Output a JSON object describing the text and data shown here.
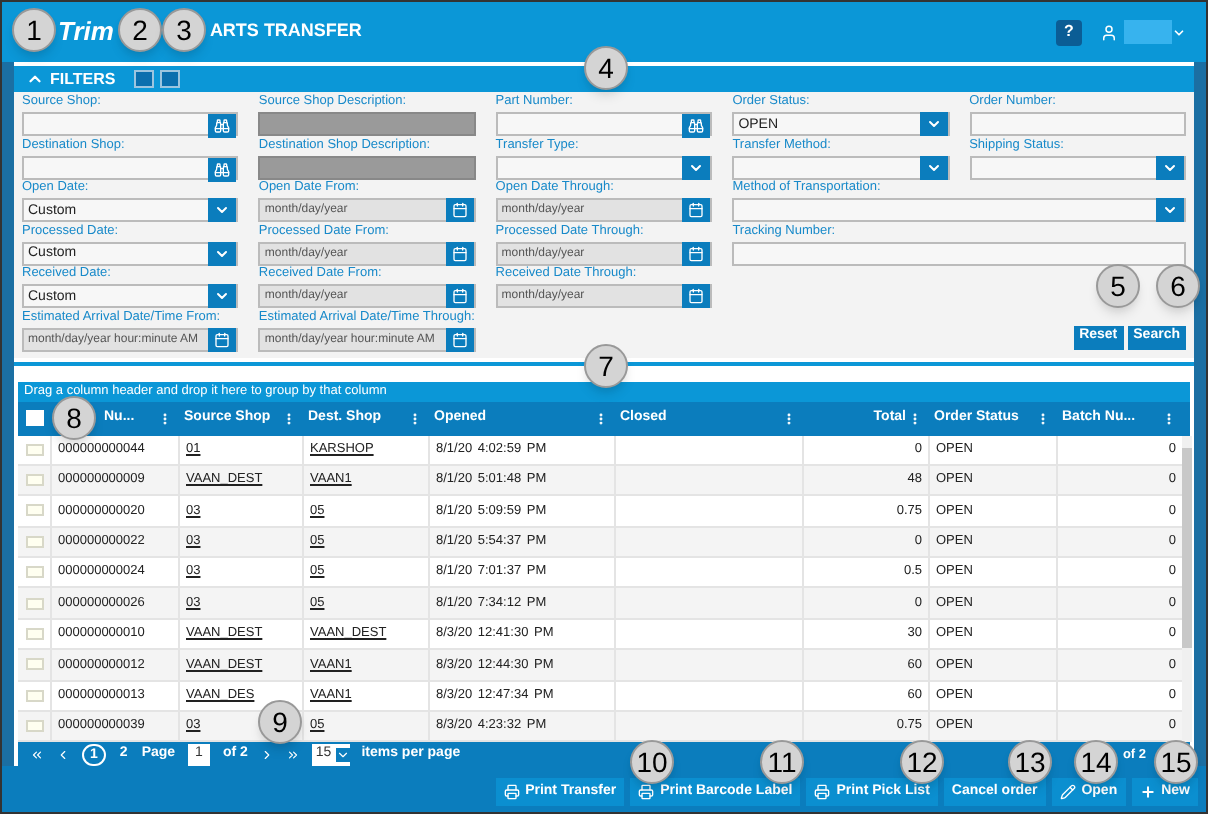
{
  "header": {
    "logo": "Trim",
    "title": "ARTS TRANSFER",
    "help": "?"
  },
  "filters": {
    "title": "FILTERS",
    "expanded": true,
    "fields": [
      {
        "label": "Source Shop:",
        "kind": "lookup"
      },
      {
        "label": "Source Shop Description:",
        "kind": "readonly"
      },
      {
        "label": "Part Number:",
        "kind": "lookup"
      },
      {
        "label": "Order Status:",
        "kind": "select",
        "value": "OPEN"
      },
      {
        "label": "Order Number:",
        "kind": "text"
      },
      {
        "label": "Destination Shop:",
        "kind": "lookup"
      },
      {
        "label": "Destination Shop Description:",
        "kind": "readonly"
      },
      {
        "label": "Transfer Type:",
        "kind": "select"
      },
      {
        "label": "Transfer Method:",
        "kind": "select"
      },
      {
        "label": "Shipping Status:",
        "kind": "select"
      },
      {
        "label": "Open Date:",
        "kind": "select",
        "value": "Custom"
      },
      {
        "label": "Open Date From:",
        "kind": "date",
        "placeholder": "month/day/year"
      },
      {
        "label": "Open Date Through:",
        "kind": "date",
        "placeholder": "month/day/year"
      },
      {
        "label": "Method of Transportation:",
        "kind": "select",
        "wide": true
      },
      {
        "label": "Processed Date:",
        "kind": "select",
        "value": "Custom"
      },
      {
        "label": "Processed Date From:",
        "kind": "date",
        "placeholder": "month/day/year"
      },
      {
        "label": "Processed Date Through:",
        "kind": "date",
        "placeholder": "month/day/year"
      },
      {
        "label": "Tracking Number:",
        "kind": "text",
        "wide": true
      },
      {
        "label": "Received Date:",
        "kind": "select",
        "value": "Custom"
      },
      {
        "label": "Received Date From:",
        "kind": "date",
        "placeholder": "month/day/year"
      },
      {
        "label": "Received Date Through:",
        "kind": "date",
        "placeholder": "month/day/year"
      },
      {
        "label": "Estimated Arrival Date/Time From:",
        "kind": "date",
        "placeholder": "month/day/year hour:minute AM",
        "newline": true
      },
      {
        "label": "Estimated Arrival Date/Time Through:",
        "kind": "date",
        "placeholder": "month/day/year hour:minute AM"
      }
    ],
    "buttons": [
      "Reset",
      "Search"
    ]
  },
  "grid": {
    "group_hint": "Drag a column header and drop it here to group by that column",
    "select_all": {
      "checked": false
    },
    "columns": [
      "Nu...",
      "Source Shop",
      "Dest. Shop",
      "Opened",
      "Closed",
      "Total",
      "Order Status",
      "Batch Nu..."
    ],
    "rows": [
      {
        "checked": false,
        "cells": [
          "000000000044",
          "01",
          "KARSHOP",
          "8/1/20 4:02:59 PM",
          "",
          "0",
          "OPEN",
          "0"
        ]
      },
      {
        "checked": false,
        "cells": [
          "000000000009",
          "VAAN_DEST",
          "VAAN1",
          "8/1/20 5:01:48 PM",
          "",
          "48",
          "OPEN",
          "0"
        ]
      },
      {
        "checked": false,
        "cells": [
          "000000000020",
          "03",
          "05",
          "8/1/20 5:09:59 PM",
          "",
          "0.75",
          "OPEN",
          "0"
        ]
      },
      {
        "checked": false,
        "cells": [
          "000000000022",
          "03",
          "05",
          "8/1/20 5:54:37 PM",
          "",
          "0",
          "OPEN",
          "0"
        ]
      },
      {
        "checked": false,
        "cells": [
          "000000000024",
          "03",
          "05",
          "8/1/20 7:01:37 PM",
          "",
          "0.5",
          "OPEN",
          "0"
        ]
      },
      {
        "checked": false,
        "cells": [
          "000000000026",
          "03",
          "05",
          "8/1/20 7:34:12 PM",
          "",
          "0",
          "OPEN",
          "0"
        ]
      },
      {
        "checked": false,
        "cells": [
          "000000000010",
          "VAAN_DEST",
          "VAAN_DEST",
          "8/3/20 12:41:30 PM",
          "",
          "30",
          "OPEN",
          "0"
        ]
      },
      {
        "checked": false,
        "cells": [
          "000000000012",
          "VAAN_DEST",
          "VAAN1",
          "8/3/20 12:44:30 PM",
          "",
          "60",
          "OPEN",
          "0"
        ]
      },
      {
        "checked": false,
        "cells": [
          "000000000013",
          "VAAN_DES",
          "VAAN1",
          "8/3/20 12:47:34 PM",
          "",
          "60",
          "OPEN",
          "0"
        ]
      },
      {
        "checked": false,
        "cells": [
          "000000000039",
          "03",
          "05",
          "8/3/20 4:23:32 PM",
          "",
          "0.75",
          "OPEN",
          "0"
        ]
      }
    ]
  },
  "pager": {
    "pages": [
      {
        "label": "1",
        "selected": true
      },
      {
        "label": "2",
        "selected": false
      }
    ],
    "page_label": "Page",
    "page_value": "1",
    "of_pages": "of 2",
    "page_size": "15",
    "page_size_label": "items per page",
    "summary": "of 2"
  },
  "toolbar": [
    {
      "label": "Print Transfer",
      "kind": "print"
    },
    {
      "label": "Print Barcode Label",
      "kind": "print"
    },
    {
      "label": "Print Pick List",
      "kind": "print"
    },
    {
      "label": "Cancel order",
      "kind": "plain"
    },
    {
      "label": "Open",
      "kind": "edit"
    },
    {
      "label": "New",
      "kind": "add"
    }
  ],
  "callouts": [
    "1",
    "2",
    "3",
    "4",
    "5",
    "6",
    "7",
    "8",
    "9",
    "10",
    "11",
    "12",
    "13",
    "14",
    "15"
  ]
}
